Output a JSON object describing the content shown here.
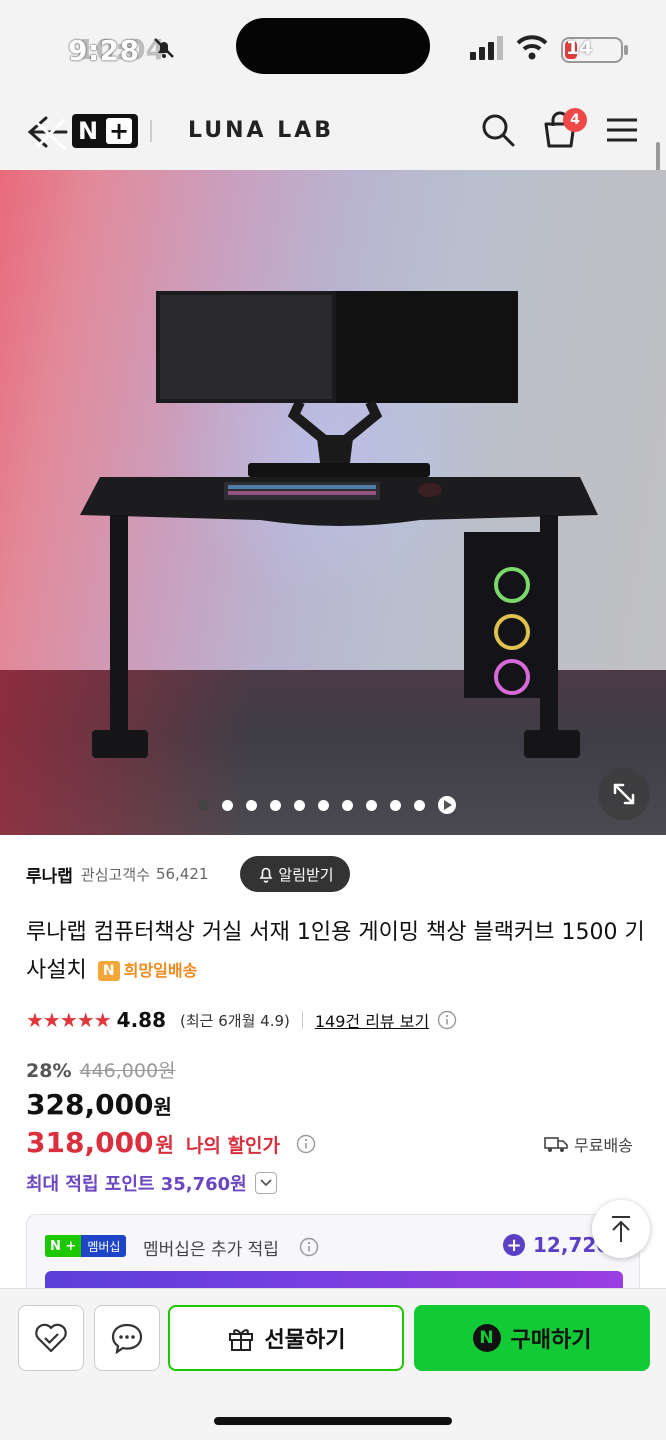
{
  "status_bar": {
    "time": "9:28",
    "time_ghost": "10:04",
    "battery": "14"
  },
  "header": {
    "nplus_label": "N",
    "brand": "LUNA LAB",
    "cart_count": "4"
  },
  "carousel": {
    "dot_count": 10,
    "active_index": 0
  },
  "seller": {
    "name": "루나랩",
    "followers_label": "관심고객수",
    "followers": "56,421",
    "alert_label": "알림받기"
  },
  "product": {
    "title": "루나랩 컴퓨터책상 거실 서재 1인용 게이밍 책상 블랙커브 1500 기사설치",
    "delivery_badge": "희망일배송",
    "delivery_badge_icon": "N"
  },
  "rating": {
    "stars": "★★★★★",
    "value": "4.88",
    "recent": "(최근 6개월 4.9)",
    "review_link": "149건 리뷰 보기"
  },
  "price": {
    "discount_rate": "28%",
    "original": "446,000원",
    "sale_value": "328,000",
    "sale_unit": "원",
    "my_value": "318,000",
    "my_unit": "원",
    "my_label": "나의 할인가",
    "free_shipping": "무료배송"
  },
  "points": {
    "label": "최대 적립 포인트 35,760원"
  },
  "membership": {
    "badge_n": "N +",
    "badge_text": "멤버십",
    "text": "멤버십은 추가 적립",
    "points": "12,720"
  },
  "bottom": {
    "gift_label": "선물하기",
    "buy_label": "구매하기",
    "buy_icon": "N"
  },
  "colors": {
    "naver_green": "#12c936",
    "sale_red": "#d92f3e",
    "points_purple": "#6b47c1",
    "star_red": "#e0373d"
  }
}
